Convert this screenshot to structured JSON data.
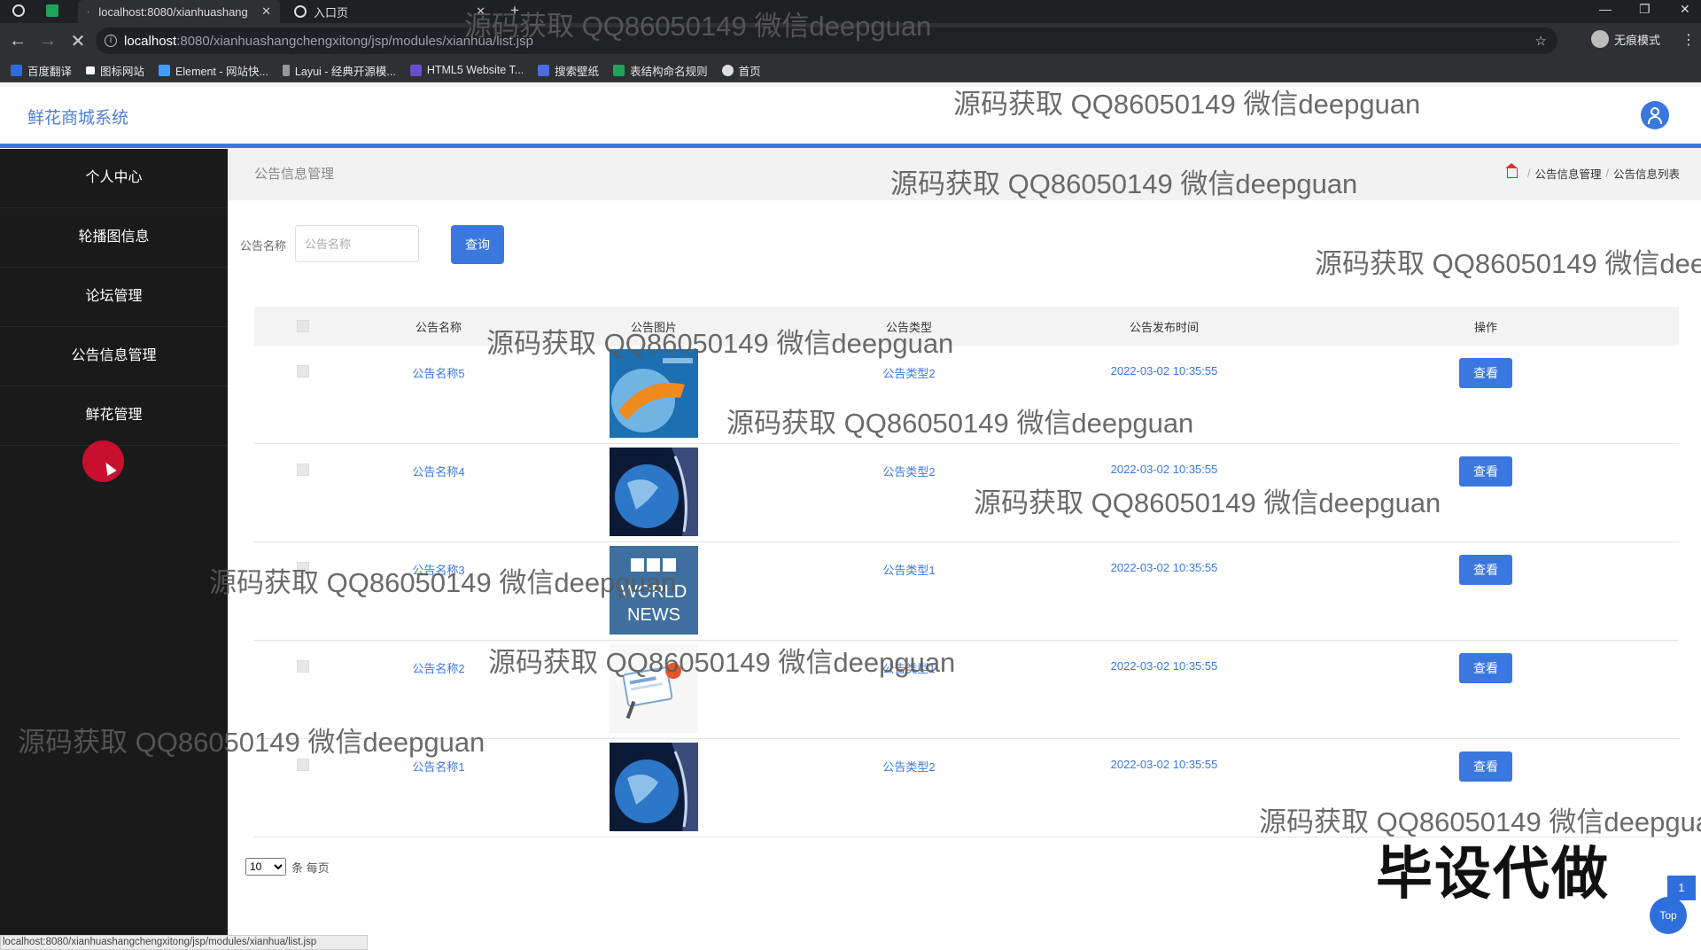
{
  "browser": {
    "tabs": [
      {
        "title": "localhost:8080/xianhuashang"
      },
      {
        "title": "入口页"
      }
    ],
    "url_host": "localhost",
    "url_path": ":8080/xianhuashangchengxitong/jsp/modules/xianhua/list.jsp",
    "incognito_label": "无痕模式",
    "bookmarks": [
      "百度翻译",
      "图标网站",
      "Element - 网站快...",
      "Layui - 经典开源模...",
      "HTML5 Website T...",
      "搜索壁纸",
      "表结构命名规则",
      "首页"
    ],
    "status_url": "localhost:8080/xianhuashangchengxitong/jsp/modules/xianhua/list.jsp"
  },
  "header": {
    "title": "鲜花商城系统"
  },
  "sidebar": {
    "items": [
      {
        "label": "个人中心"
      },
      {
        "label": "轮播图信息"
      },
      {
        "label": "论坛管理"
      },
      {
        "label": "公告信息管理"
      },
      {
        "label": "鲜花管理"
      }
    ]
  },
  "page": {
    "title": "公告信息管理",
    "breadcrumb": [
      "公告信息管理",
      "公告信息列表"
    ]
  },
  "search": {
    "label": "公告名称",
    "placeholder": "公告名称",
    "button_label": "查询"
  },
  "table": {
    "columns": [
      "公告名称",
      "公告图片",
      "公告类型",
      "公告发布时间",
      "操作"
    ],
    "rows": [
      {
        "name": "公告名称5",
        "type": "公告类型2",
        "time": "2022-03-02 10:35:55",
        "action": "查看",
        "image": "news-globe-orange"
      },
      {
        "name": "公告名称4",
        "type": "公告类型2",
        "time": "2022-03-02 10:35:55",
        "action": "查看",
        "image": "news-globe-blue"
      },
      {
        "name": "公告名称3",
        "type": "公告类型1",
        "time": "2022-03-02 10:35:55",
        "action": "查看",
        "image": "bbc-world-news"
      },
      {
        "name": "公告名称2",
        "type": "公告类型1",
        "time": "2022-03-02 10:35:55",
        "action": "查看",
        "image": "newspaper-illustration"
      },
      {
        "name": "公告名称1",
        "type": "公告类型2",
        "time": "2022-03-02 10:35:55",
        "action": "查看",
        "image": "news-globe-blue"
      }
    ]
  },
  "pager": {
    "page_size": "10",
    "suffix": "条 每页"
  },
  "watermark": "源码获取 QQ86050149 微信deepguan",
  "promo_text": "毕设代做",
  "page_number": "1",
  "top_label": "Top",
  "colors": {
    "accent": "#3a78e0",
    "sidebar_bg": "#1a1a1a",
    "header_border": "#3a78e0"
  }
}
